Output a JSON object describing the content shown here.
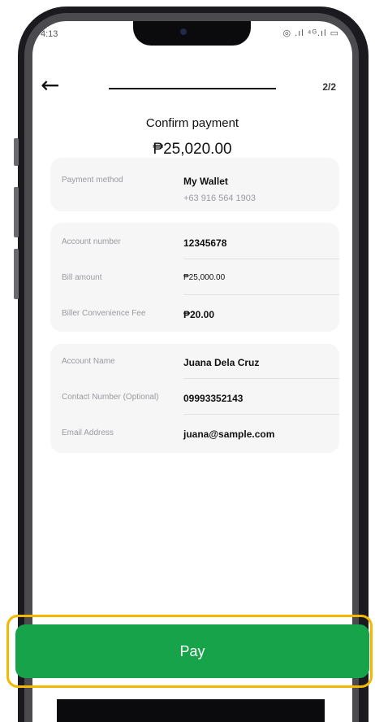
{
  "status_bar": {
    "time": "4:13",
    "icons": "◎  .ıl ⁴ᴳ.ıl ▭"
  },
  "header": {
    "back_icon": "←",
    "step": "2/2"
  },
  "title": "Confirm payment",
  "total_amount": "₱25,020.00",
  "payment_card": {
    "label": "Payment method",
    "wallet_name": "My Wallet",
    "wallet_number": "+63 916 564 1903"
  },
  "bill_card": [
    {
      "label": "Account number",
      "value": "12345678"
    },
    {
      "label": "Bill amount",
      "value": "₱25,000.00"
    },
    {
      "label": "Biller Convenience Fee",
      "value": "₱20.00"
    }
  ],
  "contact_card": [
    {
      "label": "Account Name",
      "value": "Juana Dela Cruz"
    },
    {
      "label": "Contact Number (Optional)",
      "value": "09993352143"
    },
    {
      "label": "Email Address",
      "value": "juana@sample.com"
    }
  ],
  "pay_button": {
    "label": "Pay"
  },
  "colors": {
    "accent": "#16a34a",
    "highlight": "#f4b800"
  }
}
